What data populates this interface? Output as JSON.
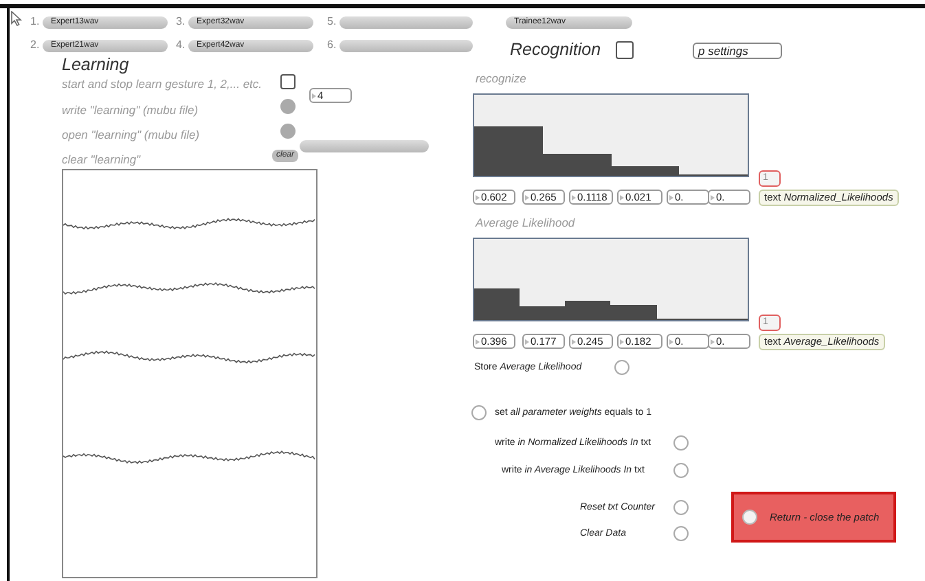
{
  "file_slots": [
    {
      "number": "1.",
      "name": "Expert13wav"
    },
    {
      "number": "2.",
      "name": "Expert21wav"
    },
    {
      "number": "3.",
      "name": "Expert32wav"
    },
    {
      "number": "4.",
      "name": "Expert42wav"
    },
    {
      "number": "5."
    },
    {
      "number": "6."
    }
  ],
  "trainee_file": {
    "name": "Trainee12wav"
  },
  "learning": {
    "title": "Learning",
    "record_toggle": {
      "label": "start and stop learn gesture 1, 2,... etc.",
      "checked": false
    },
    "gesture_number": "4",
    "write_button": {
      "label": "write \"learning\" (mubu file)"
    },
    "open_button": {
      "label": "open \"learning\" (mubu file)"
    },
    "clear_label": "clear \"learning\"",
    "clear_button": "clear"
  },
  "recognition": {
    "title": "Recognition",
    "checked": false,
    "settings": "p settings",
    "displays": [
      {
        "title": "recognize",
        "index": "1",
        "message": "text *Normalized_Likelihoods*",
        "sliders": [
          {
            "level": 0.602
          },
          {
            "level": 0.265
          },
          {
            "level": 0.1118
          },
          {
            "level": 0.021
          }
        ],
        "values": [
          "0.602",
          "0.265",
          "0.1118",
          "0.021",
          "0.",
          "0."
        ]
      },
      {
        "title": "Average Likelihood",
        "index": "1",
        "message": "text *Average_Likelihoods*",
        "sliders": [
          {
            "level": 0.396
          },
          {
            "level": 0.177
          },
          {
            "level": 0.245
          },
          {
            "level": 0.182
          },
          {
            "level": 0
          },
          {
            "level": 0
          }
        ],
        "values": [
          "0.396",
          "0.177",
          "0.245",
          "0.182",
          "0.",
          "0."
        ]
      }
    ]
  },
  "actions": [
    {
      "label": "Store *Average Likelihood*",
      "kind": "right"
    },
    {
      "label": "set *all parameter weights* equals to 1",
      "kind": "left"
    },
    {
      "label": "write *in Normalized Likelihoods In* txt",
      "kind": "right"
    },
    {
      "label": "write *in Average Likelihoods In* txt",
      "kind": "right"
    },
    {
      "label": "Reset txt Counter",
      "kind": "right"
    },
    {
      "label": "Clear Data",
      "kind": "right"
    }
  ],
  "return_button": {
    "label": "Return - close the patch"
  }
}
